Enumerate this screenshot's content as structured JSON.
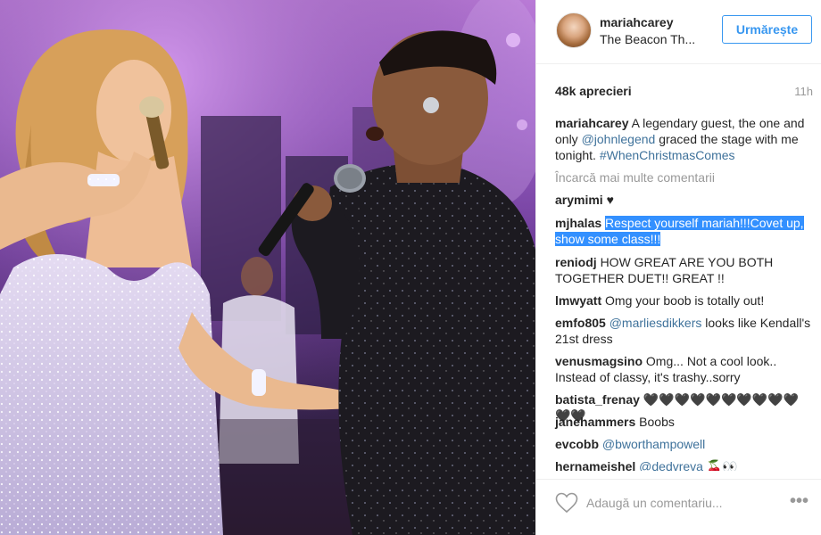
{
  "photo": {
    "subjects": [
      "singer-woman-with-microphone",
      "singer-man-with-microphone"
    ],
    "colors": {
      "stage_light": "#b97ad6",
      "dress": "#cfc6e6",
      "jacket": "#1c1a20"
    }
  },
  "header": {
    "username": "mariahcarey",
    "location": "The Beacon Th...",
    "follow_label": "Urmărește"
  },
  "stats": {
    "likes": "48k aprecieri",
    "time": "11h"
  },
  "caption": {
    "user": "mariahcarey",
    "text_1": " A legendary guest, the one and only ",
    "mention": "@johnlegend",
    "text_2": " graced the stage with me tonight. ",
    "hashtag": "#WhenChristmasComes"
  },
  "load_more": "Încarcă mai multe comentarii",
  "comments": [
    {
      "user": "arymimi",
      "text": "♥"
    },
    {
      "user": "mjhalas",
      "text": "Respect yourself mariah!!!Covet up, show some class!!!"
    },
    {
      "user": "reniodj",
      "text": "HOW GREAT ARE YOU BOTH TOGETHER DUET!! GREAT !!"
    },
    {
      "user": "lmwyatt",
      "text": "Omg your boob is totally out!"
    },
    {
      "user": "emfo805",
      "mention": "@marliesdikkers",
      "text": " looks like Kendall's 21st dress"
    },
    {
      "user": "venusmagsino",
      "text": "Omg... Not a cool look.. Instead of classy, it's trashy..sorry"
    },
    {
      "user": "batista_frenay",
      "text": "🖤🖤🖤🖤🖤🖤🖤🖤🖤🖤🖤🖤"
    },
    {
      "user": "janehammers",
      "text": "Boobs"
    },
    {
      "user": "evcobb",
      "mention": "@bworthampowell",
      "text": ""
    },
    {
      "user": "hernameishel",
      "mention": "@dedvreva",
      "text": " 🍒👀"
    }
  ],
  "footer": {
    "placeholder": "Adaugă un comentariu...",
    "more": "•••"
  },
  "accent_colors": {
    "link": "#3f729b",
    "button": "#3897f0",
    "highlight": "#3390ff"
  }
}
